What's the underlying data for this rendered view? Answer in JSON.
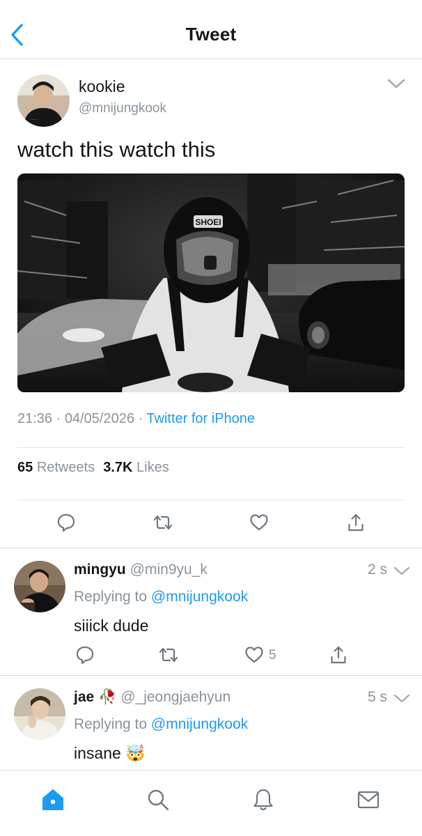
{
  "header": {
    "title": "Tweet"
  },
  "tweet": {
    "author_name": "kookie",
    "author_handle": "@mnijungkook",
    "text": "watch this watch this",
    "time": "21:36",
    "date": "04/05/2026",
    "source": "Twitter for iPhone",
    "retweets_count": "65",
    "retweets_label": "Retweets",
    "likes_count": "3.7K",
    "likes_label": "Likes"
  },
  "replies": [
    {
      "name": "mingyu",
      "handle": "@min9yu_k",
      "time": "2 s",
      "replying_prefix": "Replying to",
      "replying_to": "@mnijungkook",
      "text": "siiick dude",
      "like_count": "5"
    },
    {
      "name": "jae",
      "name_emoji": "🥀",
      "handle": "@_jeongjaehyun",
      "time": "5 s",
      "replying_prefix": "Replying to",
      "replying_to": "@mnijungkook",
      "text": "insane",
      "text_emoji": "🤯"
    }
  ],
  "colors": {
    "accent": "#1d9bf0",
    "secondary_text": "#8a939b",
    "divider": "#d9dde1"
  },
  "icons": {
    "back": "chevron-left-icon",
    "more": "chevron-down-icon",
    "reply": "speech-bubble-icon",
    "retweet": "retweet-icon",
    "like": "heart-icon",
    "share": "share-icon",
    "tabs": [
      "home-icon",
      "search-icon",
      "bell-icon",
      "mail-icon"
    ]
  }
}
